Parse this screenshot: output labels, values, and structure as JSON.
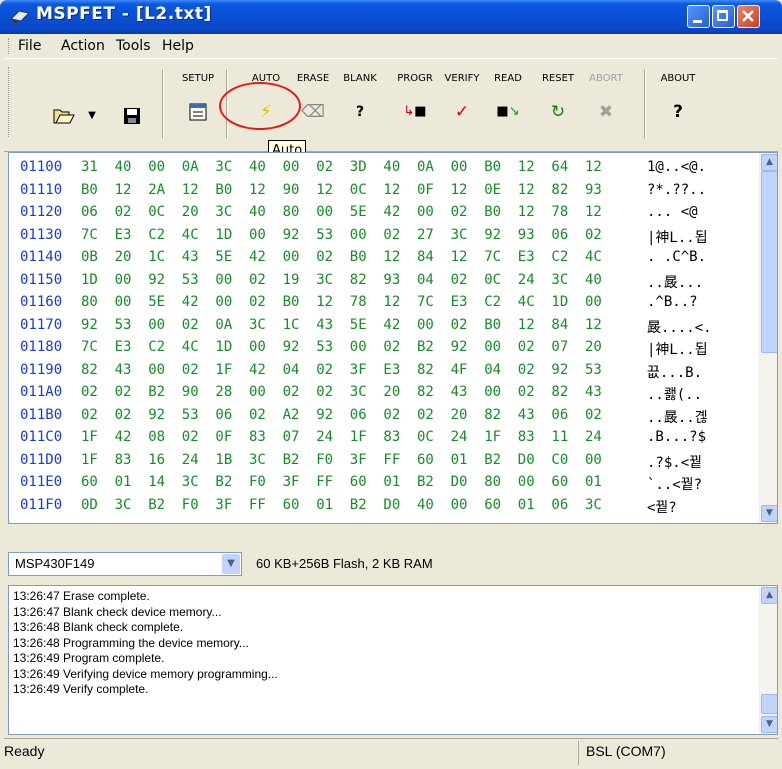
{
  "window": {
    "title": "MSPFET - [L2.txt]"
  },
  "menu": [
    "File",
    "Action",
    "Tools",
    "Help"
  ],
  "toolbar": {
    "setup": "SETUP",
    "auto": "AUTO",
    "erase": "ERASE",
    "blank": "BLANK",
    "progr": "PROGR",
    "verify": "VERIFY",
    "read": "READ",
    "reset": "RESET",
    "abort": "ABORT",
    "about": "ABOUT"
  },
  "tooltip": "Auto",
  "hex": [
    {
      "addr": "01100",
      "bytes": [
        "31",
        "40",
        "00",
        "0A",
        "3C",
        "40",
        "00",
        "02",
        "3D",
        "40",
        "0A",
        "00",
        "B0",
        "12",
        "64",
        "12"
      ],
      "ascii": "1@..<@."
    },
    {
      "addr": "01110",
      "bytes": [
        "B0",
        "12",
        "2A",
        "12",
        "B0",
        "12",
        "90",
        "12",
        "0C",
        "12",
        "0F",
        "12",
        "0E",
        "12",
        "82",
        "93"
      ],
      "ascii": "?*.??.."
    },
    {
      "addr": "01120",
      "bytes": [
        "06",
        "02",
        "0C",
        "20",
        "3C",
        "40",
        "80",
        "00",
        "5E",
        "42",
        "00",
        "02",
        "B0",
        "12",
        "78",
        "12"
      ],
      "ascii": "... <@"
    },
    {
      "addr": "01130",
      "bytes": [
        "7C",
        "E3",
        "C2",
        "4C",
        "1D",
        "00",
        "92",
        "53",
        "00",
        "02",
        "27",
        "3C",
        "92",
        "93",
        "06",
        "02"
      ],
      "ascii": "|神L..됩"
    },
    {
      "addr": "01140",
      "bytes": [
        "0B",
        "20",
        "1C",
        "43",
        "5E",
        "42",
        "00",
        "02",
        "B0",
        "12",
        "84",
        "12",
        "7C",
        "E3",
        "C2",
        "4C"
      ],
      "ascii": ". .C^B."
    },
    {
      "addr": "01150",
      "bytes": [
        "1D",
        "00",
        "92",
        "53",
        "00",
        "02",
        "19",
        "3C",
        "82",
        "93",
        "04",
        "02",
        "0C",
        "24",
        "3C",
        "40"
      ],
      "ascii": "..晸..."
    },
    {
      "addr": "01160",
      "bytes": [
        "80",
        "00",
        "5E",
        "42",
        "00",
        "02",
        "B0",
        "12",
        "78",
        "12",
        "7C",
        "E3",
        "C2",
        "4C",
        "1D",
        "00"
      ],
      "ascii": ".^B..?"
    },
    {
      "addr": "01170",
      "bytes": [
        "92",
        "53",
        "00",
        "02",
        "0A",
        "3C",
        "1C",
        "43",
        "5E",
        "42",
        "00",
        "02",
        "B0",
        "12",
        "84",
        "12"
      ],
      "ascii": "晸....<."
    },
    {
      "addr": "01180",
      "bytes": [
        "7C",
        "E3",
        "C2",
        "4C",
        "1D",
        "00",
        "92",
        "53",
        "00",
        "02",
        "B2",
        "92",
        "00",
        "02",
        "07",
        "20"
      ],
      "ascii": "|神L..됩"
    },
    {
      "addr": "01190",
      "bytes": [
        "82",
        "43",
        "00",
        "02",
        "1F",
        "42",
        "04",
        "02",
        "3F",
        "E3",
        "82",
        "4F",
        "04",
        "02",
        "92",
        "53"
      ],
      "ascii": "끖...B."
    },
    {
      "addr": "011A0",
      "bytes": [
        "02",
        "02",
        "B2",
        "90",
        "28",
        "00",
        "02",
        "02",
        "3C",
        "20",
        "82",
        "43",
        "00",
        "02",
        "82",
        "43"
      ],
      "ascii": "..쾛(.."
    },
    {
      "addr": "011B0",
      "bytes": [
        "02",
        "02",
        "92",
        "53",
        "06",
        "02",
        "A2",
        "92",
        "06",
        "02",
        "02",
        "20",
        "82",
        "43",
        "06",
        "02"
      ],
      "ascii": "..晸..곊"
    },
    {
      "addr": "011C0",
      "bytes": [
        "1F",
        "42",
        "08",
        "02",
        "0F",
        "83",
        "07",
        "24",
        "1F",
        "83",
        "0C",
        "24",
        "1F",
        "83",
        "11",
        "24"
      ],
      "ascii": ".B...?$"
    },
    {
      "addr": "011D0",
      "bytes": [
        "1F",
        "83",
        "16",
        "24",
        "1B",
        "3C",
        "B2",
        "F0",
        "3F",
        "FF",
        "60",
        "01",
        "B2",
        "D0",
        "C0",
        "00"
      ],
      "ascii": ".?$.<꿭"
    },
    {
      "addr": "011E0",
      "bytes": [
        "60",
        "01",
        "14",
        "3C",
        "B2",
        "F0",
        "3F",
        "FF",
        "60",
        "01",
        "B2",
        "D0",
        "80",
        "00",
        "60",
        "01"
      ],
      "ascii": "`..<꿭?"
    },
    {
      "addr": "011F0",
      "bytes": [
        "0D",
        "3C",
        "B2",
        "F0",
        "3F",
        "FF",
        "60",
        "01",
        "B2",
        "D0",
        "40",
        "00",
        "60",
        "01",
        "06",
        "3C"
      ],
      "ascii": "<꿭?"
    }
  ],
  "device": {
    "selected": "MSP430F149",
    "info": "60 KB+256B Flash, 2 KB RAM"
  },
  "log": [
    "13:26:47  Erase complete.",
    "13:26:47  Blank check device memory...",
    "13:26:48  Blank check complete.",
    "13:26:48  Programming the device memory...",
    "13:26:49  Program complete.",
    "13:26:49  Verifying device memory programming...",
    "13:26:49  Verify complete."
  ],
  "status": {
    "left": "Ready",
    "right": "BSL (COM7)"
  },
  "icons": [
    "open-folder-icon",
    "save-disk-icon",
    "setup-icon",
    "auto-lightning-icon",
    "erase-icon",
    "blank-check-icon",
    "program-icon",
    "verify-check-icon",
    "read-icon",
    "reset-icon",
    "abort-icon",
    "about-icon"
  ]
}
